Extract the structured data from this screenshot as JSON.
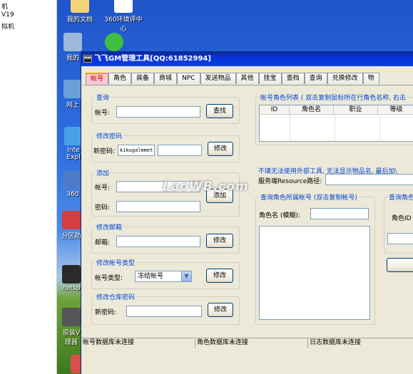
{
  "explorer": {
    "lines": [
      "机",
      "V19",
      "拟机"
    ]
  },
  "desktop": {
    "icons": [
      {
        "label": "我的文档"
      },
      {
        "label": "360环境评中心"
      },
      {
        "label": "我的"
      },
      {
        "label": "网上"
      },
      {
        "label": "Inte Expl"
      },
      {
        "label": "360"
      },
      {
        "label": "分区助"
      },
      {
        "label": "netsp"
      },
      {
        "label": "原装V 理器"
      }
    ]
  },
  "app": {
    "title": "飞飞GM管理工具[QQ:61852994]",
    "title_icon": "MM",
    "tabs": [
      "帐号",
      "角色",
      "装备",
      "商城",
      "NPC",
      "发送物品",
      "其他",
      "挂宝",
      "查档",
      "查询",
      "兑换修改",
      "物"
    ],
    "account": {
      "query": {
        "legend": "查询",
        "account_label": "帐号:",
        "account_value": "",
        "search_button": "查找"
      },
      "change_password": {
        "legend": "修改密码",
        "new_password_label": "新密码:",
        "new_password_value": "kikugalmmet",
        "second_value": "",
        "button": "修改"
      },
      "add": {
        "legend": "添加",
        "account_label": "帐号:",
        "password_label": "密码:",
        "button": "添加"
      },
      "change_email": {
        "legend": "修改邮箱",
        "email_label": "邮箱:",
        "button": "修改"
      },
      "change_type": {
        "legend": "修改帐号类型",
        "type_label": "帐号类型:",
        "type_selected": "冻结帐号",
        "button": "修改"
      },
      "change_warehouse_password": {
        "legend": "修改仓库密码",
        "new_password_label": "新密码:",
        "button": "修改"
      }
    },
    "role_list": {
      "legend": "帐号角色列表 ( 双击复制鼠标所在行角色名称, 右击",
      "columns": [
        "ID",
        "角色名",
        "职业",
        "等级"
      ]
    },
    "notice": "不填无法使用外部工具, 无法显示物品名, 最后加\\",
    "resource": {
      "label": "服务端Resource路径:"
    },
    "query_account_by_role": {
      "legend": "查询角色所属帐号 (双击复制帐号)",
      "role_label": "角色名 (模糊):"
    },
    "query_role_right": {
      "legend": "查询角色",
      "role_id_label": "角色ID"
    },
    "status": [
      "帐号数据库未连接",
      "角色数据库未连接",
      "日志数据库未连接"
    ]
  },
  "watermark": "LaoWB.com"
}
